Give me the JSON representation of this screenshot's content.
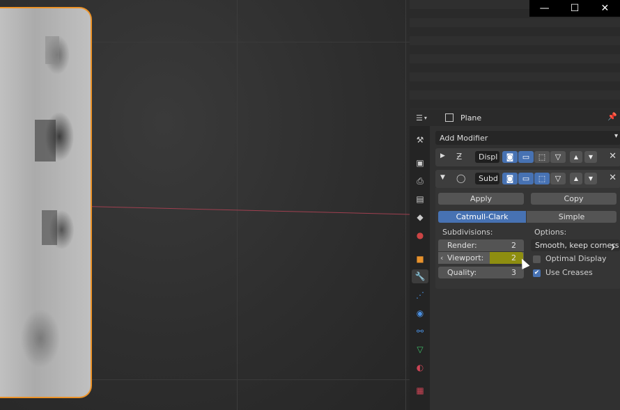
{
  "window": {
    "controls": [
      "—",
      "☐",
      "✕"
    ]
  },
  "header": {
    "object_name": "Plane"
  },
  "toolbar": {
    "add_modifier": "Add Modifier"
  },
  "modifiers": [
    {
      "name": "Displ",
      "expanded": false
    },
    {
      "name": "Subd",
      "expanded": true
    }
  ],
  "subdivision": {
    "apply_label": "Apply",
    "copy_label": "Copy",
    "type_options": [
      "Catmull-Clark",
      "Simple"
    ],
    "selected_type": "Catmull-Clark",
    "subdivisions_label": "Subdivisions:",
    "render_label": "Render:",
    "render_value": "2",
    "viewport_label": "Viewport:",
    "viewport_value": "2",
    "quality_label": "Quality:",
    "quality_value": "3",
    "options_label": "Options:",
    "uv_smooth_value": "Smooth, keep corners",
    "optimal_display_label": "Optimal Display",
    "optimal_display_checked": false,
    "use_creases_label": "Use Creases",
    "use_creases_checked": true
  },
  "colors": {
    "accent": "#4772b3",
    "selection_outline": "#e8922c",
    "highlight": "#8e8e10"
  }
}
